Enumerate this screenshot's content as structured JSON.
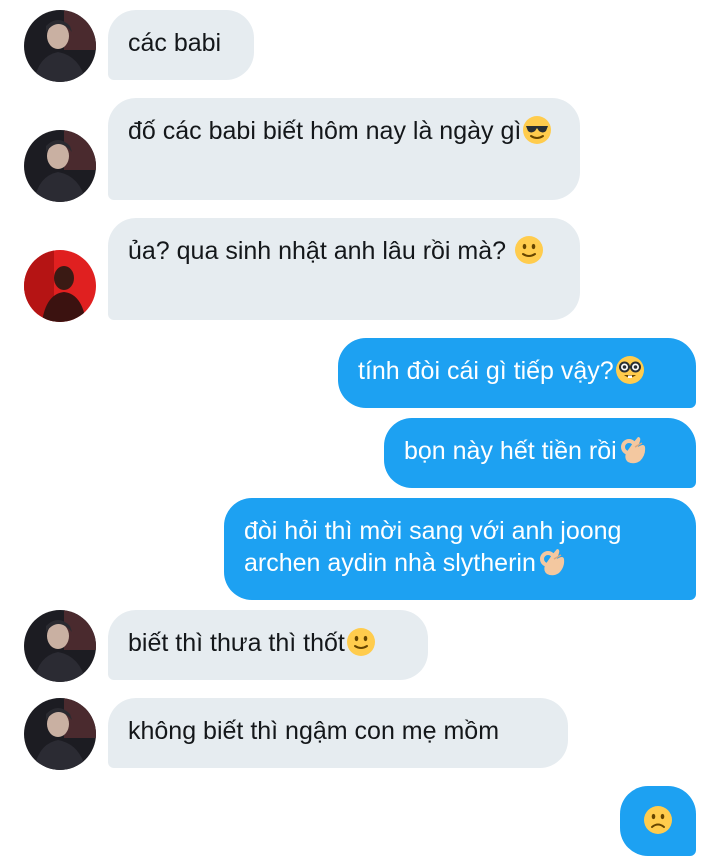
{
  "conversation": {
    "messages": [
      {
        "sender": "other",
        "text": "các babi",
        "emoji": ""
      },
      {
        "sender": "other",
        "text": "đố các babi biết hôm nay là ngày gì",
        "emoji": "sunglasses-face"
      },
      {
        "sender": "other-red",
        "text": "ủa? qua sinh nhật anh lâu rồi mà?",
        "emoji": "slightly-smiling-face"
      },
      {
        "sender": "me",
        "text": "tính đòi cái gì tiếp vậy?",
        "emoji": "nerd-face"
      },
      {
        "sender": "me",
        "text": "bọn này hết tiền rồi",
        "emoji": "ok-hand"
      },
      {
        "sender": "me",
        "text": "đòi hỏi thì mời sang với anh joong archen aydin nhà slytherin",
        "emoji": "ok-hand"
      },
      {
        "sender": "other",
        "text": "biết thì thưa thì thốt",
        "emoji": "slightly-smiling-face"
      },
      {
        "sender": "other",
        "text": "không biết thì ngậm con mẹ mồm",
        "emoji": ""
      },
      {
        "sender": "me",
        "text": "",
        "emoji": "slightly-frowning-face"
      }
    ]
  },
  "colors": {
    "incoming_bubble": "#e6ecf0",
    "outgoing_bubble": "#1da1f2",
    "incoming_text": "#14171a",
    "outgoing_text": "#ffffff"
  }
}
